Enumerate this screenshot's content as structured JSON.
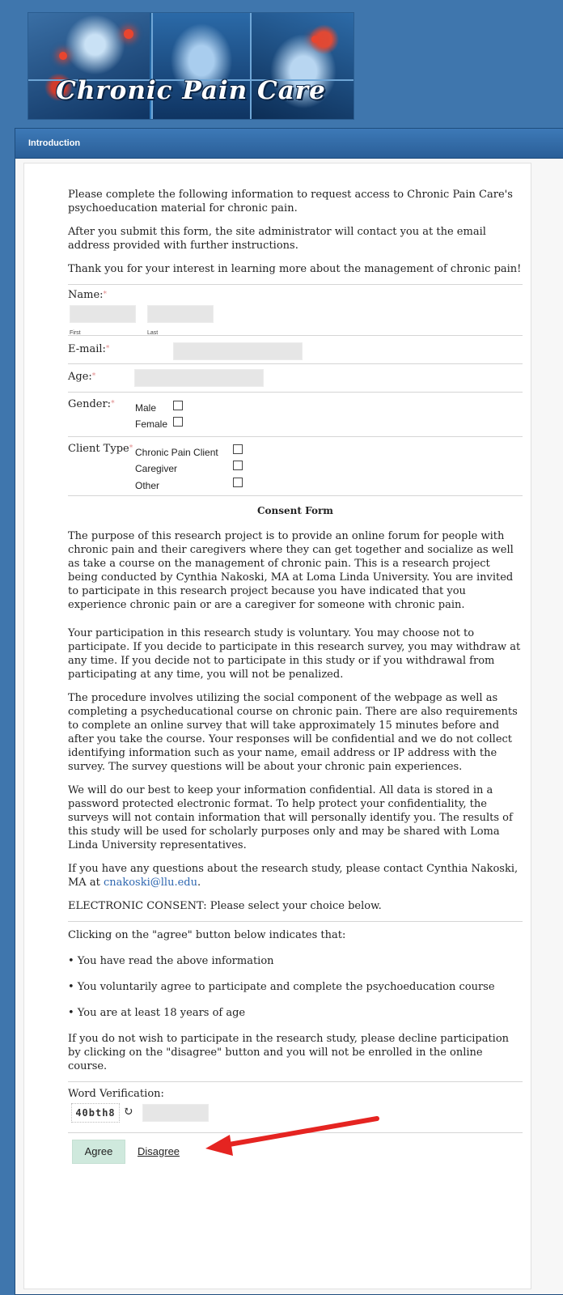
{
  "banner": {
    "title": "Chronic Pain Care"
  },
  "panel": {
    "header": "Introduction"
  },
  "intro": {
    "p1": "Please complete the following information to request access to Chronic Pain Care's psychoeducation material for chronic pain.",
    "p2": "After you submit this form, the site administrator will contact you at the email address provided with further instructions.",
    "p3": "Thank you for your interest in learning more about the management of chronic pain!"
  },
  "form": {
    "name_label": "Name:",
    "first_label": "First",
    "last_label": "Last",
    "email_label": "E-mail:",
    "age_label": "Age:",
    "gender_label": "Gender:",
    "gender_options": [
      "Male",
      "Female"
    ],
    "client_type_label": "Client Type",
    "client_type_options": [
      "Chronic Pain Client",
      "Caregiver",
      "Other"
    ],
    "required_marker": "*"
  },
  "consent": {
    "title": "Consent Form",
    "paragraphs": [
      "The purpose of this research project is to provide an online forum for people with chronic pain and their caregivers where they can get together and socialize as well as take a course on the management of chronic pain. This is a research project being conducted by Cynthia Nakoski, MA at Loma Linda University. You are invited to participate in this research project because you have indicated that you experience chronic pain or are a caregiver for someone with chronic pain.",
      "Your participation in this research study is voluntary. You may choose not to participate. If you decide to participate in this research survey, you may withdraw at any time. If you decide not to participate in this study or if you withdrawal from participating at any time, you will not be penalized.",
      "The procedure involves utilizing the social component of the webpage as well as completing a psycheducational course on chronic pain. There are also requirements to complete an online survey that will take approximately 15 minutes before and after you take the course. Your responses will be confidential and we do not collect identifying information such as your name, email address or IP address with the survey. The survey questions will be about your chronic pain experiences.",
      "We will do our best to keep your information confidential. All data is stored in a password protected electronic format. To help protect your confidentiality, the surveys will not contain information that will personally identify you. The results of this study will be used for scholarly purposes only and may be shared with Loma Linda University representatives."
    ],
    "contact_text": "If you have any questions about the research study, please contact Cynthia Nakoski, MA at",
    "contact_email": "cnakoski@llu.edu",
    "contact_end": ".",
    "electronic": "ELECTRONIC CONSENT: Please select your choice below.",
    "clicking": "Clicking on the \"agree\" button below indicates that:",
    "bullets": [
      "• You have read the above information",
      "• You voluntarily agree to participate and complete the psychoeducation course",
      "• You are at least 18 years of age"
    ],
    "decline": "If you do not wish to participate in the research study, please decline participation by clicking on the \"disagree\" button and you will not be enrolled in the online course."
  },
  "verification": {
    "label": "Word Verification:",
    "captcha_text": "40bth8",
    "refresh_icon": "↻"
  },
  "actions": {
    "agree": "Agree",
    "disagree": "Disagree"
  },
  "annotation": {
    "arrow_color": "#e52421"
  }
}
